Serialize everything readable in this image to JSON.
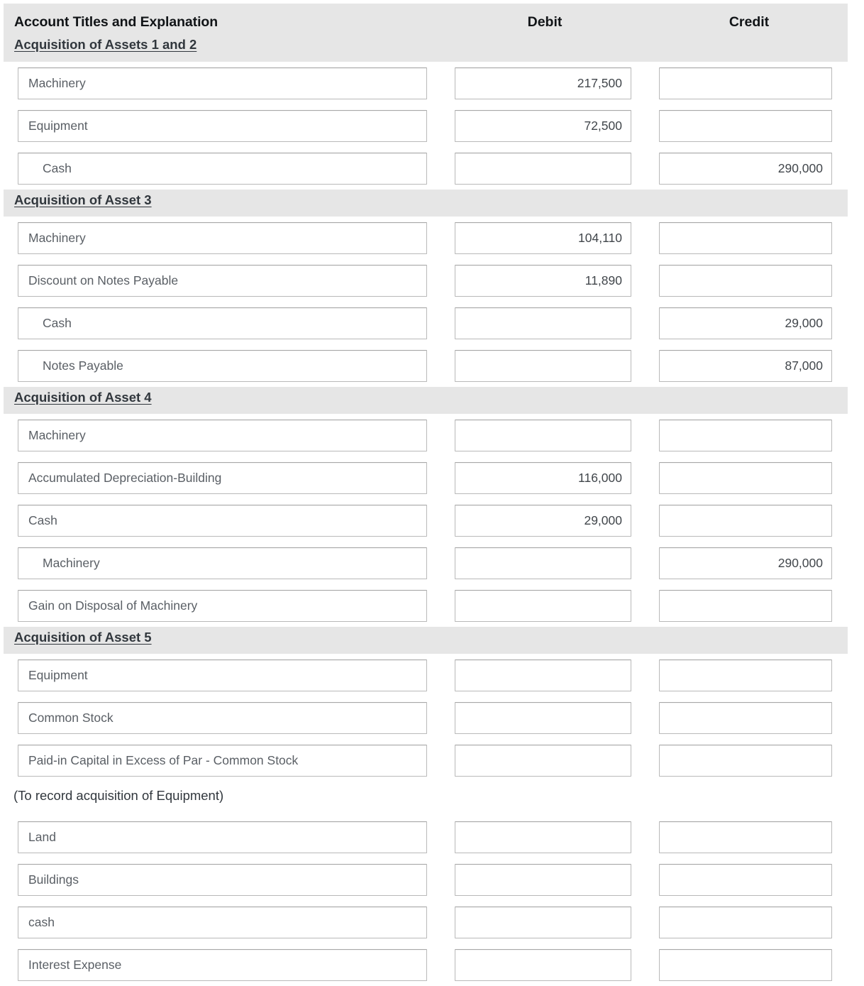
{
  "table": {
    "columns": {
      "account": "Account Titles and Explanation",
      "debit": "Debit",
      "credit": "Credit"
    },
    "sections": [
      {
        "title": "Acquisition of Assets 1 and 2",
        "rows": [
          {
            "account": "Machinery",
            "indent": false,
            "debit": "217,500",
            "credit": ""
          },
          {
            "account": "Equipment",
            "indent": false,
            "debit": "72,500",
            "credit": ""
          },
          {
            "account": "Cash",
            "indent": true,
            "debit": "",
            "credit": "290,000"
          }
        ]
      },
      {
        "title": "Acquisition of Asset 3",
        "rows": [
          {
            "account": "Machinery",
            "indent": false,
            "debit": "104,110",
            "credit": ""
          },
          {
            "account": "Discount on Notes Payable",
            "indent": false,
            "debit": "11,890",
            "credit": ""
          },
          {
            "account": "Cash",
            "indent": true,
            "debit": "",
            "credit": "29,000"
          },
          {
            "account": "Notes Payable",
            "indent": true,
            "debit": "",
            "credit": "87,000"
          }
        ]
      },
      {
        "title": "Acquisition of Asset 4",
        "rows": [
          {
            "account": "Machinery",
            "indent": false,
            "debit": "",
            "credit": ""
          },
          {
            "account": "Accumulated Depreciation-Building",
            "indent": false,
            "debit": "116,000",
            "credit": ""
          },
          {
            "account": "Cash",
            "indent": false,
            "debit": "29,000",
            "credit": ""
          },
          {
            "account": "Machinery",
            "indent": true,
            "debit": "",
            "credit": "290,000"
          },
          {
            "account": "Gain on Disposal of Machinery",
            "indent": false,
            "debit": "",
            "credit": ""
          }
        ]
      },
      {
        "title": "Acquisition of Asset 5",
        "rows": [
          {
            "account": "Equipment",
            "indent": false,
            "debit": "",
            "credit": ""
          },
          {
            "account": "Common Stock",
            "indent": false,
            "debit": "",
            "credit": ""
          },
          {
            "account": "Paid-in Capital in Excess of Par - Common Stock",
            "indent": false,
            "debit": "",
            "credit": ""
          }
        ],
        "memo": "(To record acquisition of Equipment)",
        "memo_rows": [
          {
            "account": "Land",
            "indent": false,
            "debit": "",
            "credit": ""
          },
          {
            "account": "Buildings",
            "indent": false,
            "debit": "",
            "credit": ""
          },
          {
            "account": "cash",
            "indent": false,
            "debit": "",
            "credit": ""
          },
          {
            "account": "Interest Expense",
            "indent": false,
            "debit": "",
            "credit": ""
          }
        ]
      }
    ]
  }
}
